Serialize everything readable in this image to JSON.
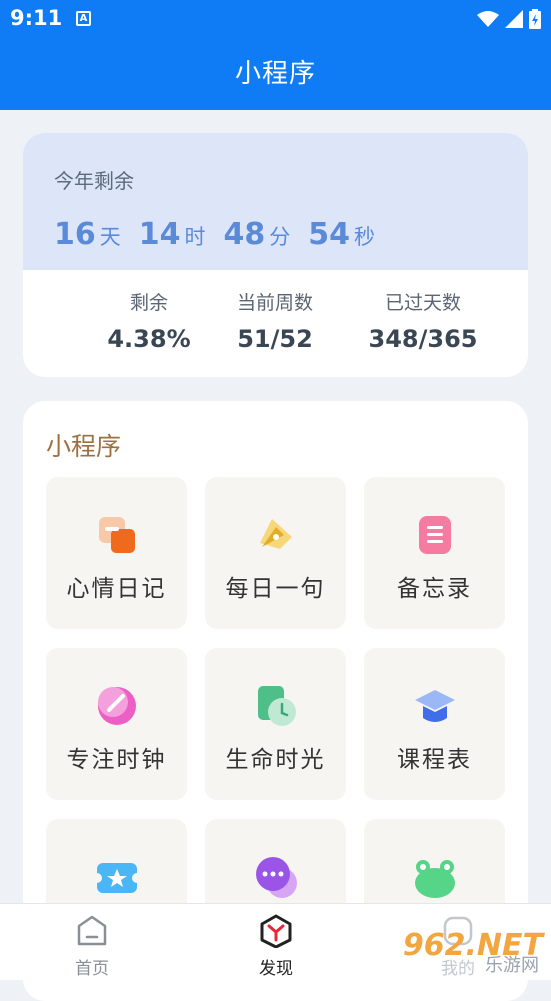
{
  "status_bar": {
    "time": "9:11",
    "notif_letter": "A"
  },
  "app_bar": {
    "title": "小程序"
  },
  "countdown": {
    "label": "今年剩余",
    "days": "16",
    "days_unit": "天",
    "hours": "14",
    "hours_unit": "时",
    "minutes": "48",
    "minutes_unit": "分",
    "seconds": "54",
    "seconds_unit": "秒",
    "stats": [
      {
        "label": "剩余",
        "value": "4.38%"
      },
      {
        "label": "当前周数",
        "value": "51/52"
      },
      {
        "label": "已过天数",
        "value": "348/365"
      }
    ]
  },
  "mini_programs": {
    "title": "小程序",
    "items": [
      {
        "label": "心情日记",
        "icon": "mood-diary-icon"
      },
      {
        "label": "每日一句",
        "icon": "pen-icon"
      },
      {
        "label": "备忘录",
        "icon": "memo-icon"
      },
      {
        "label": "专注时钟",
        "icon": "focus-clock-icon"
      },
      {
        "label": "生命时光",
        "icon": "life-time-icon"
      },
      {
        "label": "课程表",
        "icon": "graduation-cap-icon"
      },
      {
        "label": "",
        "icon": "ticket-star-icon"
      },
      {
        "label": "",
        "icon": "chat-bubble-icon"
      },
      {
        "label": "",
        "icon": "frog-icon"
      }
    ]
  },
  "tab_bar": {
    "tabs": [
      {
        "label": "首页",
        "active": false
      },
      {
        "label": "发现",
        "active": true
      },
      {
        "label": "我的",
        "active": false
      }
    ]
  },
  "watermark": {
    "text": "962.NET",
    "sub": "乐游网"
  },
  "colors": {
    "primary": "#0f7cf6",
    "accent_text": "#5b8ad9",
    "section_title": "#9c7142"
  }
}
